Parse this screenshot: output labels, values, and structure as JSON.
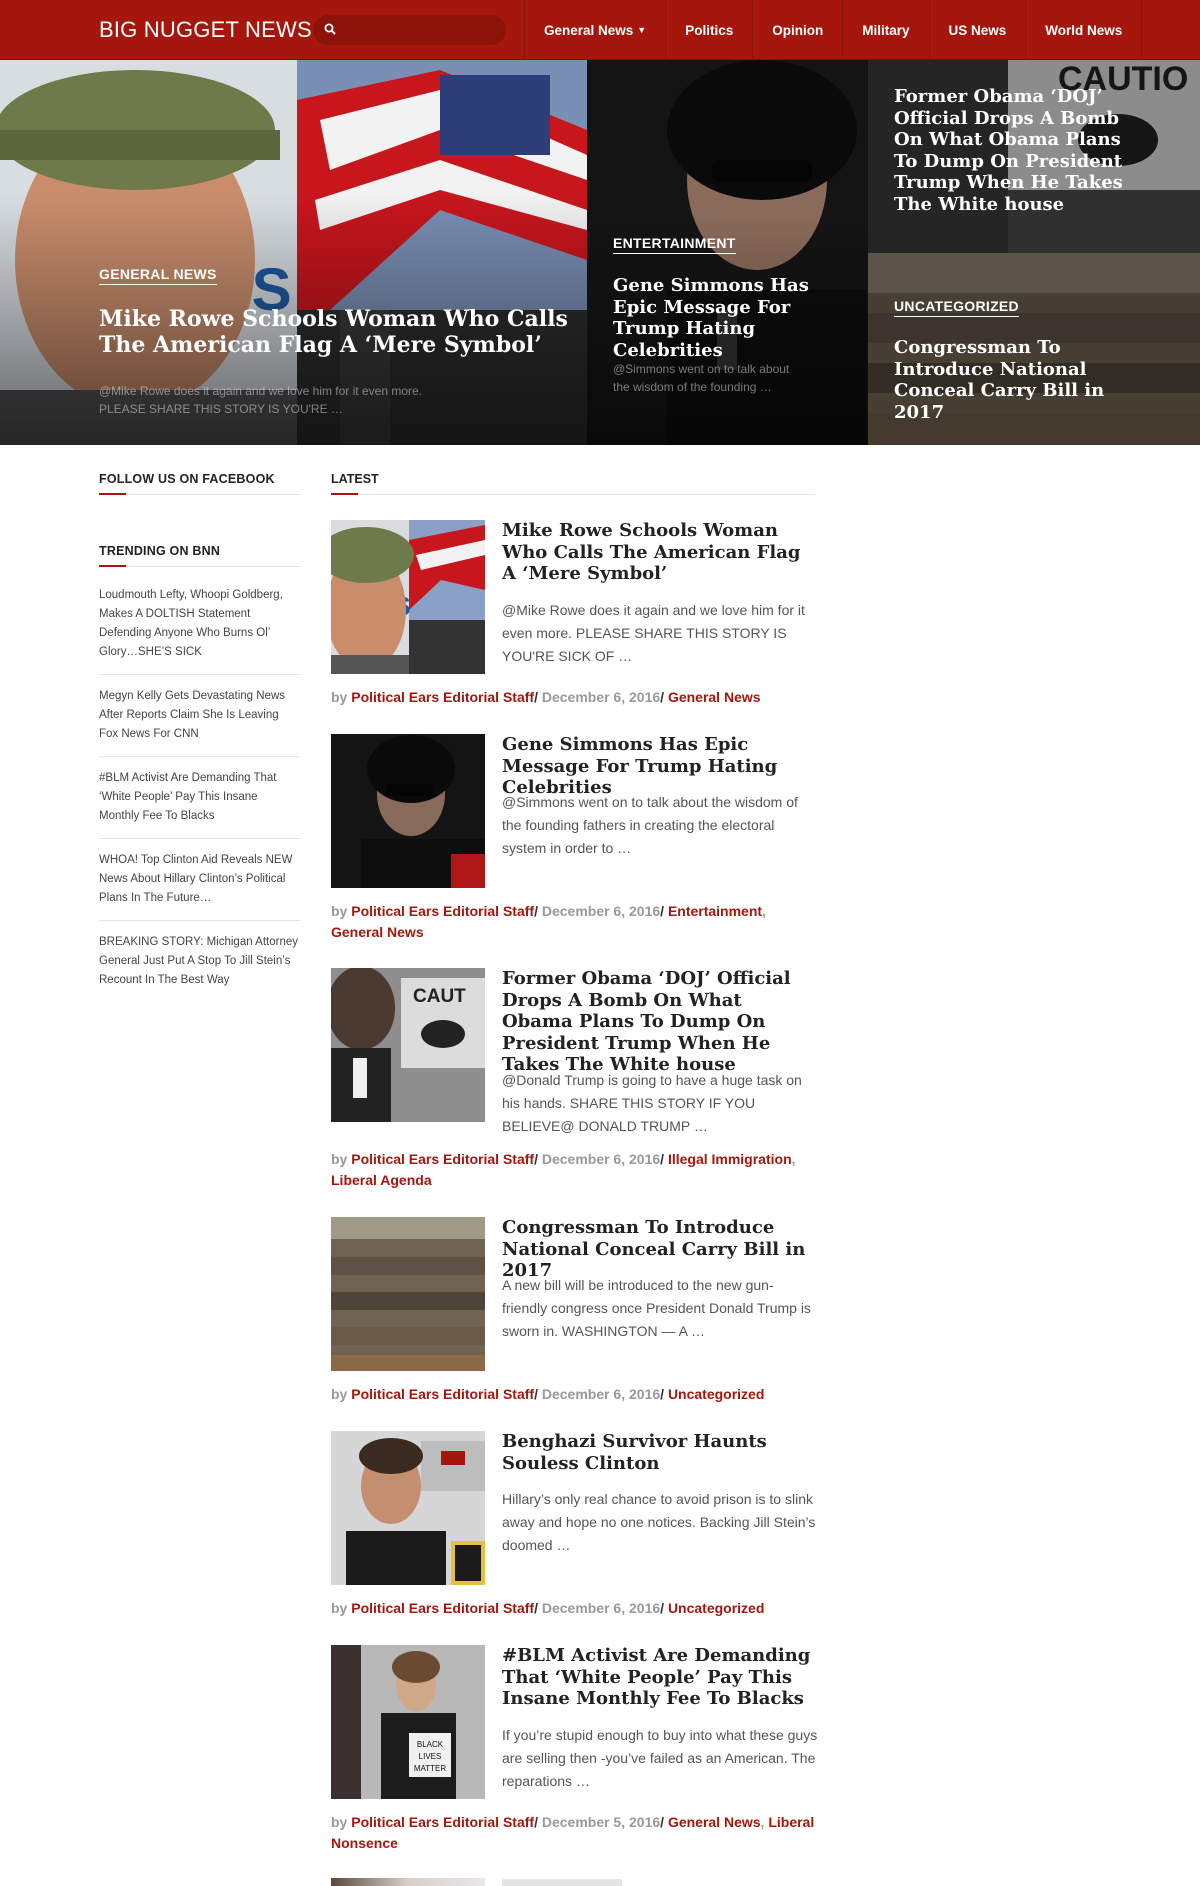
{
  "header": {
    "logo": "BIG NUGGET NEWS",
    "search_placeholder": "",
    "nav": [
      "General News",
      "Politics",
      "Opinion",
      "Military",
      "US News",
      "World News"
    ]
  },
  "hero": [
    {
      "category": "GENERAL NEWS",
      "title": "Mike Rowe Schools Woman Who Calls The American Flag A ‘Mere Symbol’",
      "excerpt": "@Mike Rowe does it again and we love him for it even more. PLEASE SHARE THIS STORY IS YOU'RE …"
    },
    {
      "category": "ENTERTAINMENT",
      "title": "Gene Simmons Has Epic Message For Trump Hating Celebrities",
      "excerpt": "@Simmons went on to talk about the wisdom of the founding …"
    },
    {
      "category": "",
      "title": "Former Obama ‘DOJ’ Official Drops A Bomb On What Obama Plans To Dump On President Trump When He Takes The White house",
      "excerpt": ""
    },
    {
      "category": "UNCATEGORIZED",
      "title": "Congressman To Introduce National Conceal Carry Bill in 2017",
      "excerpt": ""
    }
  ],
  "sidebar": {
    "facebook_heading": "FOLLOW US ON FACEBOOK",
    "trending_heading": "TRENDING ON BNN",
    "trending": [
      "Loudmouth Lefty, Whoopi Goldberg, Makes A DOLTISH Statement Defending Anyone Who Burns Ol’ Glory…SHE’S SICK",
      "Megyn Kelly Gets Devastating News After Reports Claim She Is Leaving Fox News For CNN",
      "#BLM Activist Are Demanding That ‘White People’ Pay This Insane Monthly Fee To Blacks",
      "WHOA! Top Clinton Aid Reveals NEW News About Hillary Clinton’s Political Plans In The Future…",
      "BREAKING STORY: Michigan Attorney General Just Put A Stop To Jill Stein’s Recount In The Best Way"
    ]
  },
  "latest": {
    "heading": "LATEST",
    "by": "by",
    "sep": "/",
    "comma": ",",
    "articles": [
      {
        "title": "Mike Rowe Schools Woman Who Calls The American Flag A ‘Mere Symbol’",
        "excerpt": "@Mike Rowe does it again and we love him for it even more. PLEASE SHARE THIS STORY IS YOU'RE SICK OF …",
        "author": "Political Ears Editorial Staff",
        "date": "December 6, 2016",
        "categories": [
          "General News"
        ]
      },
      {
        "title": "Gene Simmons Has Epic Message For Trump Hating Celebrities",
        "excerpt": "@Simmons went on to talk about the wisdom of the founding fathers in creating the electoral system in order to …",
        "author": "Political Ears Editorial Staff",
        "date": "December 6, 2016",
        "categories": [
          "Entertainment",
          "General News"
        ]
      },
      {
        "title": "Former Obama ‘DOJ’ Official Drops A Bomb On What Obama Plans To Dump On President Trump When He Takes The White house",
        "excerpt": "@Donald Trump is going to have a huge task on his hands. SHARE THIS STORY IF YOU BELIEVE@ DONALD TRUMP …",
        "author": "Political Ears Editorial Staff",
        "date": "December 6, 2016",
        "categories": [
          "Illegal Immigration",
          "Liberal Agenda"
        ]
      },
      {
        "title": "Congressman To Introduce National Conceal Carry Bill in 2017",
        "excerpt": "A new bill will be introduced to the new gun-friendly congress once President Donald Trump is sworn in. WASHINGTON — A …",
        "author": "Political Ears Editorial Staff",
        "date": "December 6, 2016",
        "categories": [
          "Uncategorized"
        ]
      },
      {
        "title": "Benghazi Survivor Haunts Souless Clinton",
        "excerpt": "Hillary’s only real chance to avoid prison is to slink away and hope no one notices. Backing Jill Stein’s doomed …",
        "author": "Political Ears Editorial Staff",
        "date": "December 6, 2016",
        "categories": [
          "Uncategorized"
        ]
      },
      {
        "title": "#BLM Activist Are Demanding That ‘White People’ Pay This Insane Monthly Fee To Blacks",
        "excerpt": "If you’re stupid enough to buy into what these guys are selling then -you’ve failed as an American. The reparations …",
        "author": "Political Ears Editorial Staff",
        "date": "December 5, 2016",
        "categories": [
          "General News",
          "Liberal Nonsence"
        ]
      }
    ]
  },
  "icons": {
    "search": "search-icon",
    "caret": "chevron-down-icon"
  },
  "colors": {
    "brand": "#a5170c",
    "brand_dark": "#8d130a",
    "meta_grey": "#999999"
  }
}
